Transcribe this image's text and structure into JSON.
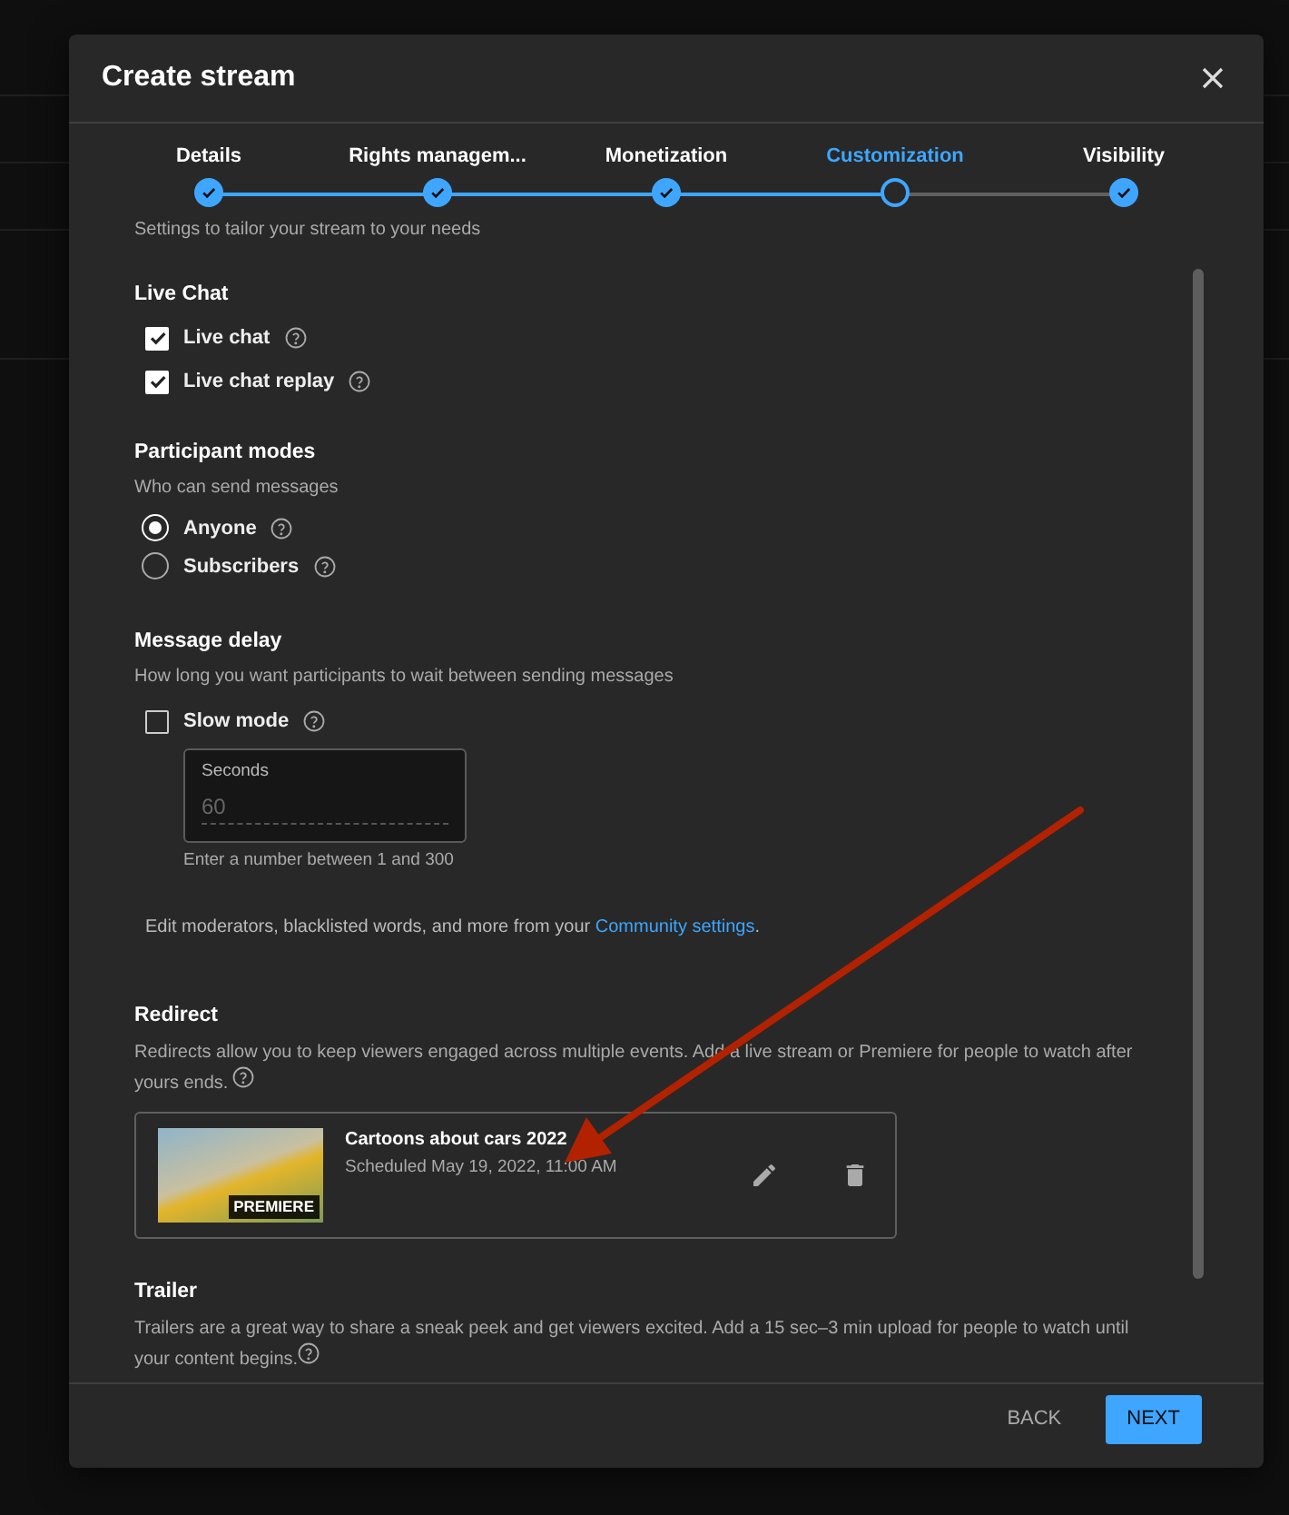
{
  "dialog": {
    "title": "Create stream"
  },
  "steps": [
    {
      "label": "Details",
      "selected": false
    },
    {
      "label": "Rights managem...",
      "selected": false
    },
    {
      "label": "Monetization",
      "selected": false
    },
    {
      "label": "Customization",
      "selected": true
    },
    {
      "label": "Visibility",
      "selected": false
    }
  ],
  "intro": "Settings to tailor your stream to your needs",
  "live_chat": {
    "title": "Live Chat",
    "options": [
      {
        "label": "Live chat",
        "checked": true
      },
      {
        "label": "Live chat replay",
        "checked": true
      }
    ]
  },
  "participant_modes": {
    "title": "Participant modes",
    "subtitle": "Who can send messages",
    "options": [
      {
        "label": "Anyone",
        "selected": true
      },
      {
        "label": "Subscribers",
        "selected": false
      }
    ]
  },
  "message_delay": {
    "title": "Message delay",
    "subtitle": "How long you want participants to wait between sending messages",
    "slow_mode": {
      "label": "Slow mode",
      "checked": false
    },
    "seconds_field": {
      "label": "Seconds",
      "placeholder": "60",
      "hint": "Enter a number between 1 and 300"
    }
  },
  "community_note": {
    "text": "Edit moderators, blacklisted words, and more from your ",
    "link": "Community settings",
    "end": "."
  },
  "redirect": {
    "title": "Redirect",
    "description": "Redirects allow you to keep viewers engaged across multiple events. Add a live stream or Premiere for people to watch after yours ends.",
    "card": {
      "title": "Cartoons about cars 2022",
      "schedule": "Scheduled May 19, 2022, 11:00 AM",
      "badge": "PREMIERE"
    }
  },
  "trailer": {
    "title": "Trailer",
    "description": "Trailers are a great way to share a sneak peek and get viewers excited. Add a 15 sec–3 min upload for people to watch until your content begins."
  },
  "footer": {
    "buttons": [
      {
        "label": "BACK",
        "kind": "text"
      },
      {
        "label": "NEXT",
        "kind": "primary"
      }
    ]
  }
}
